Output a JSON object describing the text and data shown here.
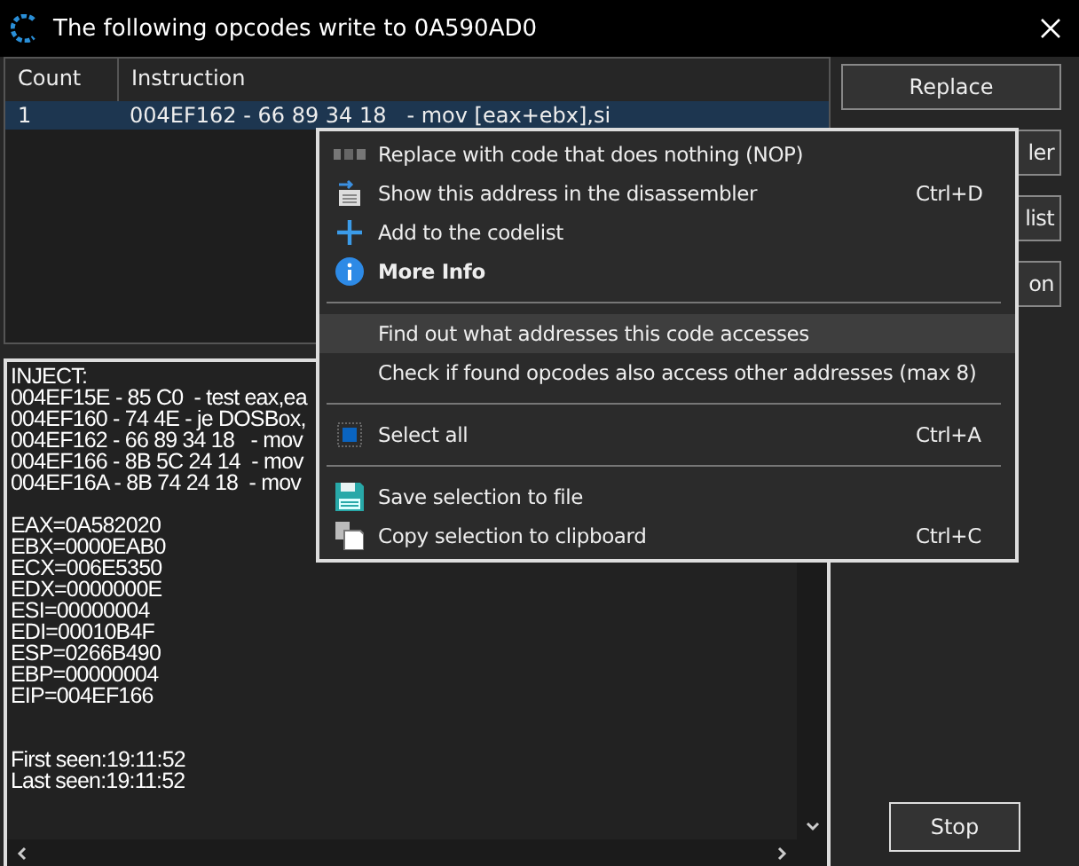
{
  "window": {
    "title": "The following opcodes write to 0A590AD0"
  },
  "table": {
    "columns": [
      "Count",
      "Instruction"
    ],
    "rows": [
      {
        "cells": [
          "1",
          "004EF162 - 66 89 34 18   - mov [eax+ebx],si"
        ],
        "selected": true
      }
    ]
  },
  "buttons": [
    {
      "label": "Replace"
    },
    {
      "label": "ler"
    },
    {
      "label": "list"
    },
    {
      "label": "on"
    }
  ],
  "details": {
    "trace": [
      "INJECT:",
      "004EF15E - 85 C0  - test eax,ea",
      "004EF160 - 74 4E - je DOSBox,",
      "004EF162 - 66 89 34 18   - mov",
      "004EF166 - 8B 5C 24 14  - mov",
      "004EF16A - 8B 74 24 18  - mov"
    ],
    "registers": [
      "EAX=0A582020",
      "EBX=0000EAB0",
      "ECX=006E5350",
      "EDX=0000000E",
      "ESI=00000004",
      "EDI=00010B4F",
      "ESP=0266B490",
      "EBP=00000004",
      "EIP=004EF166"
    ],
    "times": [
      "First seen:19:11:52",
      "Last seen:19:11:52"
    ]
  },
  "stop_button": {
    "label": "Stop"
  },
  "context_menu": {
    "items": [
      {
        "kind": "item",
        "label": "Replace with code that does nothing (NOP)",
        "selected": false,
        "bold": false
      },
      {
        "kind": "item",
        "label": "Show this address in the disassembler",
        "shortcut": "Ctrl+D",
        "selected": false,
        "bold": false
      },
      {
        "kind": "item",
        "label": "Add to the codelist",
        "selected": false,
        "bold": false
      },
      {
        "kind": "item",
        "label": "More Info",
        "selected": false,
        "bold": true
      },
      {
        "kind": "separator"
      },
      {
        "kind": "item",
        "label": "Find out what addresses this code accesses",
        "selected": true,
        "bold": false
      },
      {
        "kind": "item",
        "label": "Check if found opcodes also access other addresses (max 8)",
        "selected": false,
        "bold": false
      },
      {
        "kind": "separator"
      },
      {
        "kind": "item",
        "label": "Select all",
        "shortcut": "Ctrl+A",
        "selected": false,
        "bold": false
      },
      {
        "kind": "separator"
      },
      {
        "kind": "item",
        "label": "Save selection to file",
        "selected": false,
        "bold": false
      },
      {
        "kind": "item",
        "label": "Copy selection to clipboard",
        "shortcut": "Ctrl+C",
        "selected": false,
        "bold": false
      }
    ]
  }
}
